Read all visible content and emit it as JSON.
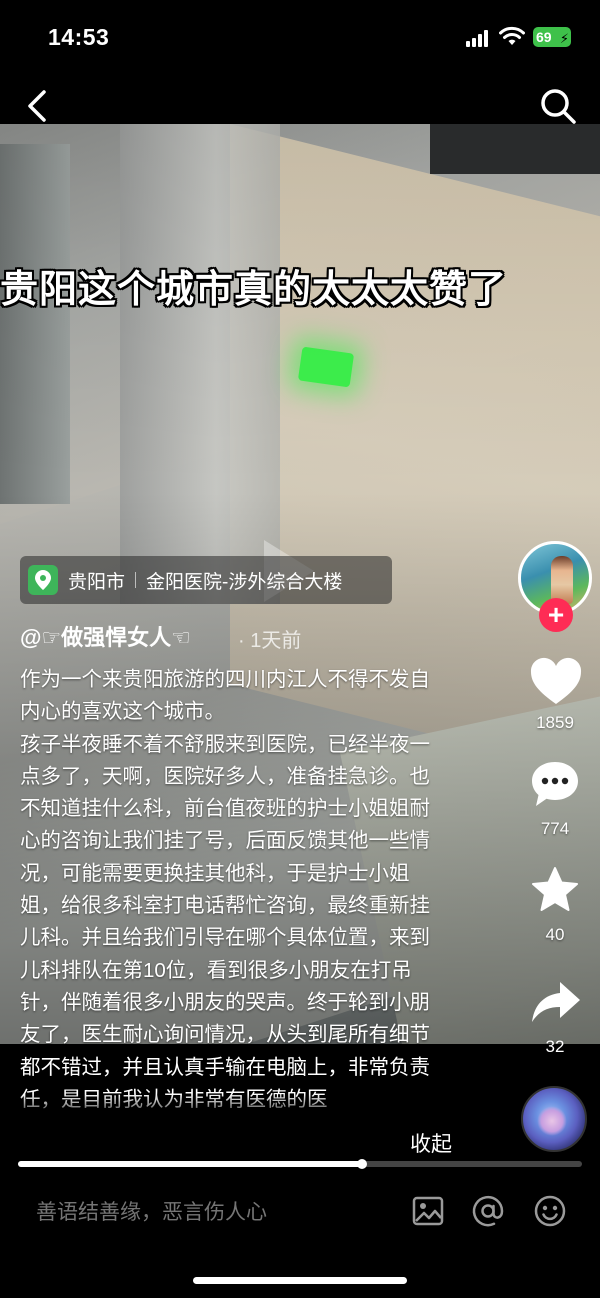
{
  "status_bar": {
    "time": "14:53",
    "battery": "69",
    "icons": [
      "signal-icon",
      "wifi-icon",
      "battery-icon"
    ],
    "battery_color": "#3ec14a"
  },
  "nav": {
    "back_icon": "chevron-left-icon",
    "search_icon": "search-icon"
  },
  "video": {
    "title_overlay": "贵阳这个城市真的太太太赞了",
    "play_icon": "play-icon"
  },
  "location": {
    "city": "贵阳市",
    "place": "金阳医院-涉外综合大楼",
    "icon": "location-pin-icon",
    "icon_color": "#3eb55a"
  },
  "author": {
    "name": "@☞做强悍女人☜",
    "time": "· 1天前"
  },
  "description": {
    "paragraphs": [
      "作为一个来贵阳旅游的四川内江人不得不发自内心的喜欢这个城市。",
      "孩子半夜睡不着不舒服来到医院，已经半夜一点多了，天啊，医院好多人，准备挂急诊。也不知道挂什么科，前台值夜班的护士小姐姐耐心的咨询让我们挂了号，后面反馈其他一些情况，可能需要更换挂其他科，于是护士小姐姐，给很多科室打电话帮忙咨询，最终重新挂儿科。并且给我们引导在哪个具体位置，来到儿科排队在第10位，看到很多小朋友在打吊针，伴随着很多小朋友的哭声。终于轮到小朋友了，医生耐心询问情况，从头到尾所有细节都不错过，并且认真手输在电脑上，非常负责任，是目前我认为非常有医德的医"
    ],
    "collapse_label": "收起"
  },
  "actions": {
    "follow_icon": "plus-icon",
    "follow_color": "#fe2c55",
    "like_icon": "heart-icon",
    "like_count": "1859",
    "comment_icon": "comment-icon",
    "comment_count": "774",
    "favorite_icon": "star-icon",
    "favorite_count": "40",
    "share_icon": "share-icon",
    "share_count": "32",
    "music_icon": "music-disc-icon"
  },
  "progress": {
    "fraction": 0.61
  },
  "comment_bar": {
    "placeholder": "善语结善缘，恶言伤人心",
    "icons": [
      "image-icon",
      "at-icon",
      "emoji-icon"
    ]
  }
}
